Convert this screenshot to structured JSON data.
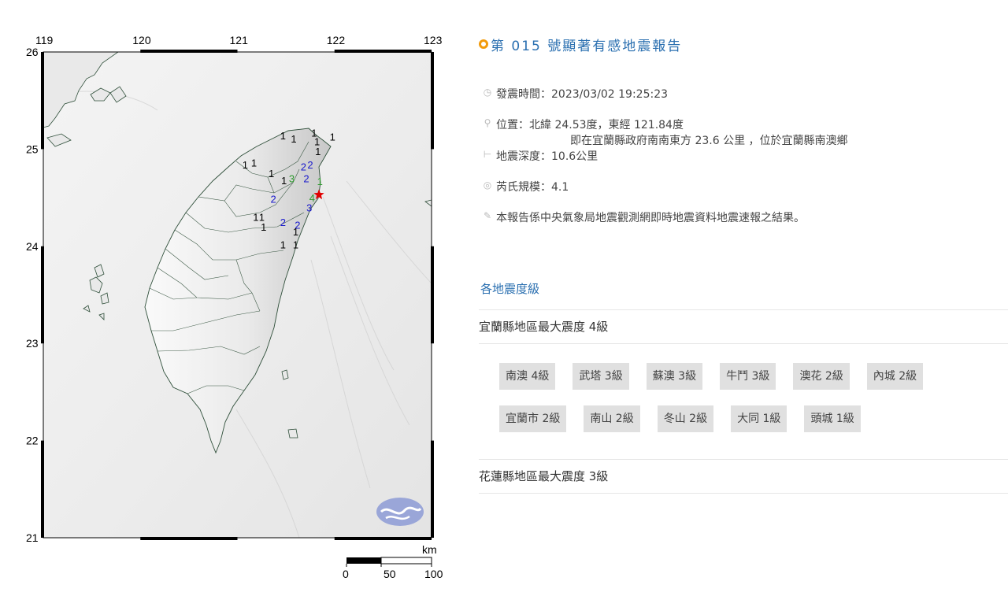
{
  "map": {
    "lon_ticks": [
      "119",
      "120",
      "121",
      "122",
      "123"
    ],
    "lat_ticks": [
      "26",
      "25",
      "24",
      "23",
      "22",
      "21"
    ],
    "scale": {
      "unit": "km",
      "labels": [
        "0",
        "50",
        "100"
      ]
    },
    "epicenter_color": "#e00000",
    "intensity_labels": [
      {
        "v": "1",
        "c": "#000000",
        "lon": 121.47,
        "lat": 25.1
      },
      {
        "v": "1",
        "c": "#000000",
        "lon": 121.58,
        "lat": 25.07
      },
      {
        "v": "1",
        "c": "#000000",
        "lon": 121.79,
        "lat": 25.13
      },
      {
        "v": "1",
        "c": "#000000",
        "lon": 121.82,
        "lat": 25.04
      },
      {
        "v": "1",
        "c": "#000000",
        "lon": 121.98,
        "lat": 25.09
      },
      {
        "v": "1",
        "c": "#000000",
        "lon": 121.83,
        "lat": 24.94
      },
      {
        "v": "1",
        "c": "#000000",
        "lon": 121.08,
        "lat": 24.8
      },
      {
        "v": "1",
        "c": "#000000",
        "lon": 121.17,
        "lat": 24.82
      },
      {
        "v": "1",
        "c": "#000000",
        "lon": 121.35,
        "lat": 24.71
      },
      {
        "v": "1",
        "c": "#000000",
        "lon": 121.48,
        "lat": 24.64
      },
      {
        "v": "3",
        "c": "#2e9a2e",
        "lon": 121.56,
        "lat": 24.66
      },
      {
        "v": "2",
        "c": "#1a1acc",
        "lon": 121.68,
        "lat": 24.78
      },
      {
        "v": "2",
        "c": "#1a1acc",
        "lon": 121.75,
        "lat": 24.8
      },
      {
        "v": "2",
        "c": "#1a1acc",
        "lon": 121.71,
        "lat": 24.66
      },
      {
        "v": "1",
        "c": "#2e9a2e",
        "lon": 121.85,
        "lat": 24.63
      },
      {
        "v": "2",
        "c": "#1a1acc",
        "lon": 121.37,
        "lat": 24.45
      },
      {
        "v": "4",
        "c": "#2e9a2e",
        "lon": 121.77,
        "lat": 24.46
      },
      {
        "v": "3",
        "c": "#1a1acc",
        "lon": 121.74,
        "lat": 24.36
      },
      {
        "v": "1",
        "c": "#000000",
        "lon": 121.19,
        "lat": 24.26
      },
      {
        "v": "1",
        "c": "#000000",
        "lon": 121.25,
        "lat": 24.26
      },
      {
        "v": "1",
        "c": "#000000",
        "lon": 121.27,
        "lat": 24.16
      },
      {
        "v": "2",
        "c": "#1a1acc",
        "lon": 121.47,
        "lat": 24.21
      },
      {
        "v": "2",
        "c": "#1a1acc",
        "lon": 121.62,
        "lat": 24.18
      },
      {
        "v": "1",
        "c": "#000000",
        "lon": 121.6,
        "lat": 24.11
      },
      {
        "v": "1",
        "c": "#000000",
        "lon": 121.47,
        "lat": 23.98
      },
      {
        "v": "1",
        "c": "#000000",
        "lon": 121.6,
        "lat": 23.98
      }
    ]
  },
  "report": {
    "title": "第 015 號顯著有感地震報告",
    "time": "發震時間：2023/03/02 19:25:23",
    "location_line1": "位置：北緯 24.53度，東經 121.84度",
    "location_line2": "即在宜蘭縣政府南南東方 23.6 公里 ，位於宜蘭縣南澳鄉",
    "depth": "地震深度：10.6公里",
    "magnitude": "芮氏規模：4.1",
    "note": "本報告係中央氣象局地震觀測網即時地震資料地震速報之結果。",
    "section_title": "各地震度級",
    "regions": [
      {
        "title": "宜蘭縣地區最大震度 4級",
        "stations": [
          "南澳 4級",
          "武塔 3級",
          "蘇澳 3級",
          "牛鬥 3級",
          "澳花 2級",
          "內城 2級",
          "宜蘭市 2級",
          "南山 2級",
          "冬山 2級",
          "大同 1級",
          "頭城 1級"
        ]
      },
      {
        "title": "花蓮縣地區最大震度 3級",
        "stations": []
      }
    ]
  },
  "icons": [
    "clock-icon",
    "location-pin-icon",
    "depth-icon",
    "magnitude-icon",
    "pencil-icon"
  ]
}
